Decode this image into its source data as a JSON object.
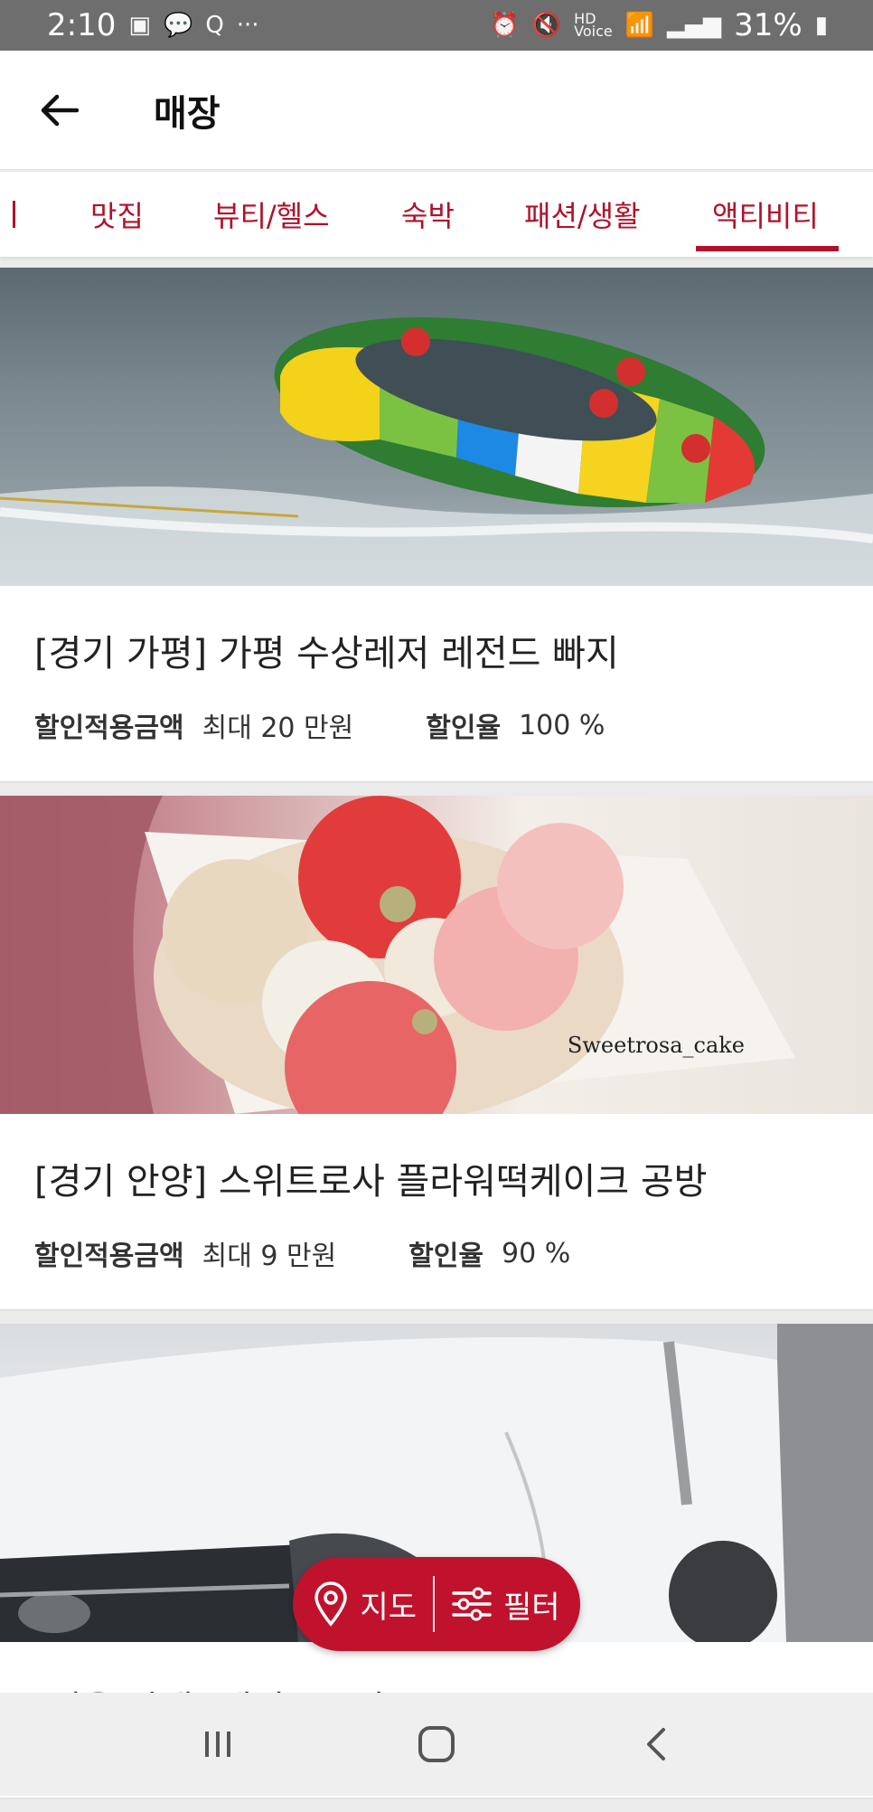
{
  "status_bar": {
    "time": "2:10",
    "left_icons": [
      "gallery-icon",
      "talk-icon",
      "q-icon",
      "more-dots-icon"
    ],
    "battery": "31%",
    "right_icons": [
      "alarm-icon",
      "mute-icon",
      "hd-voice-icon",
      "wifi-icon",
      "signal-icon",
      "battery-icon"
    ]
  },
  "header": {
    "title": "매장",
    "back_icon": "arrow-left-icon"
  },
  "tabs": {
    "items": [
      {
        "label": "맛집"
      },
      {
        "label": "뷰티/헬스"
      },
      {
        "label": "숙박"
      },
      {
        "label": "패션/생활"
      },
      {
        "label": "액티비티"
      }
    ],
    "active": "액티비티",
    "accent_color": "#b0122a"
  },
  "stores": [
    {
      "title": "[경기 가평] 가평 수상레저 레전드 빠지",
      "amount_label": "할인적용금액",
      "amount_value": "최대 20 만원",
      "rate_label": "할인율",
      "rate_value": "100 %",
      "image": "water-tube-photo"
    },
    {
      "title": "[경기 안양] 스위트로사 플라워떡케이크 공방",
      "amount_label": "할인적용금액",
      "amount_value": "최대 9 만원",
      "rate_label": "할인율",
      "rate_value": "90 %",
      "image": "flower-cake-photo",
      "image_caption": "Sweetrosa_cake"
    },
    {
      "title": "[서울 양재] 케이오모터스",
      "image": "white-car-photo"
    }
  ],
  "fab": {
    "map_label": "지도",
    "filter_label": "필터",
    "color": "#c0122d"
  },
  "nav_bar": {
    "icons": [
      "recent-apps-icon",
      "home-icon",
      "back-icon"
    ]
  }
}
